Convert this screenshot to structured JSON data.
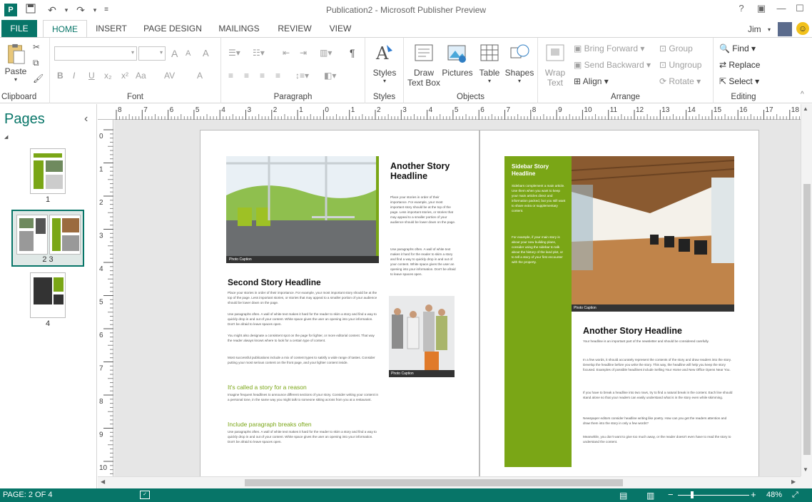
{
  "window": {
    "title": "Publication2 - Microsoft Publisher Preview",
    "app_icon_letter": "P",
    "help": "?",
    "user": "Jim"
  },
  "tabs": [
    "FILE",
    "HOME",
    "INSERT",
    "PAGE DESIGN",
    "MAILINGS",
    "REVIEW",
    "VIEW"
  ],
  "ribbon": {
    "clipboard": {
      "paste": "Paste",
      "label": "Clipboard"
    },
    "font": {
      "label": "Font",
      "bold": "B",
      "italic": "I",
      "underline": "U",
      "subscript": "x₂",
      "superscript": "x²",
      "change_case": "Aa",
      "grow": "A",
      "shrink": "A",
      "clear": "A",
      "spacing": "AV",
      "color": "A"
    },
    "paragraph": {
      "label": "Paragraph",
      "pilcrow": "¶"
    },
    "styles": {
      "button": "Styles",
      "label": "Styles"
    },
    "objects": {
      "draw_textbox_1": "Draw",
      "draw_textbox_2": "Text Box",
      "pictures": "Pictures",
      "table": "Table",
      "shapes": "Shapes",
      "label": "Objects"
    },
    "arrange": {
      "wrap_1": "Wrap",
      "wrap_2": "Text",
      "bring_forward": "Bring Forward",
      "send_backward": "Send Backward",
      "align": "Align",
      "group": "Group",
      "ungroup": "Ungroup",
      "rotate": "Rotate",
      "label": "Arrange"
    },
    "editing": {
      "find": "Find",
      "replace": "Replace",
      "select": "Select",
      "label": "Editing"
    }
  },
  "pages_pane": {
    "title": "Pages",
    "collapse": "‹",
    "thumbs": [
      {
        "label": "1"
      },
      {
        "label": "2   3"
      },
      {
        "label": "4"
      }
    ]
  },
  "ruler": {
    "h_ticks": [
      "8",
      "7",
      "6",
      "5",
      "4",
      "3",
      "2",
      "1",
      "0",
      "1",
      "2",
      "3",
      "4",
      "5",
      "6",
      "7",
      "8",
      "9",
      "10",
      "11",
      "12",
      "13",
      "14",
      "15",
      "16",
      "17",
      "18"
    ],
    "v_ticks": [
      "0",
      "1",
      "2",
      "3",
      "4",
      "5",
      "6",
      "7",
      "8",
      "9",
      "10"
    ]
  },
  "document": {
    "left": {
      "photo_caption": "Photo Caption",
      "another_headline": "Another Story Headline",
      "another_body_1": "Place your stories in order of their importance. For example, your most important story should be at the top of the page. Less important stories, or stories that may appeal to a smaller portion of your audience should be lower down on the page.",
      "another_body_2": "Use paragraphs often. A wall of white text makes it hard for the reader to skim a story and find a way to quickly drop in and out of your content. White space gives the user an opening into your information. Don't be afraid to leave spaces open.",
      "small_caption": "Photo Caption",
      "second_headline": "Second Story Headline",
      "second_body_1": "Place your stories in order of their importance. For example, your most important story should be at the top of the page. Less important stories, or stories that may appeal to a smaller portion of your audience should be lower down on the page.",
      "second_body_2": "Use paragraphs often. A wall of white text makes it hard for the reader to skim a story and find a way to quickly drop in and out of your content. White space gives the user an opening into your information. Don't be afraid to leave spaces open.",
      "second_body_3": "You might also designate a consistent spot on the page for lighter, or more editorial content. That way the reader always knows where to look for a certain type of content.",
      "second_body_4": "Most successful publications include a mix of content types to satisfy a wide range of tastes. Consider putting your most serious content on the front page, and your lighter content inside.",
      "sub_1": "It's called a story for a reason",
      "sub_1_body": "Imagine frequent headlines to announce different sections of your story. Consider writing your content in a personal tone, in the same way you might talk to someone sitting across from you at a restaurant.",
      "sub_2": "Include paragraph breaks often",
      "sub_2_body": "Use paragraphs often. A wall of white text makes it hard for the reader to skim a story and find a way to quickly drop in and out of your content. White space gives the user an opening into your information. Don't be afraid to leave spaces open."
    },
    "right": {
      "sidebar_headline": "Sidebar Story Headline",
      "sidebar_body_1": "Sidebars complement a main article. Use them when you want to keep your main articles direct and information packed, but you still want to share extra or supplementary content.",
      "sidebar_body_2": "For example, if your main story is about your new building plans, consider using the sidebar to talk about the history of the land plot, or to tell a story of your first encounter with the property.",
      "photo_caption": "Photo Caption",
      "headline": "Another Story Headline",
      "body_1": "Your headline is an important part of the newsletter and should be considered carefully.",
      "body_2": "In a few words, it should accurately represent the contents of the story and draw readers into the story. Develop the headline before you write the story. This way, the headline will help you keep the story focused. Examples of possible headlines include Selling Your Home and New Office Opens Near You.",
      "body_3": "If you have to break a headline into two rows, try to find a natural break in the content. Each line should stand alone so that your readers can easily understand what is in the story even while skimming.",
      "body_4": "Newspaper editors consider headline writing like poetry. How can you get the readers attention and draw them into the story in only a few words?",
      "body_5": "Meanwhile, you don't want to give too much away, or the reader doesn't even have to read the story to understand the content."
    }
  },
  "status": {
    "page": "PAGE: 2 OF 4",
    "zoom": "48%",
    "zoom_minus": "−",
    "zoom_plus": "+"
  },
  "colors": {
    "accent": "#077568",
    "green": "#7aa616"
  }
}
